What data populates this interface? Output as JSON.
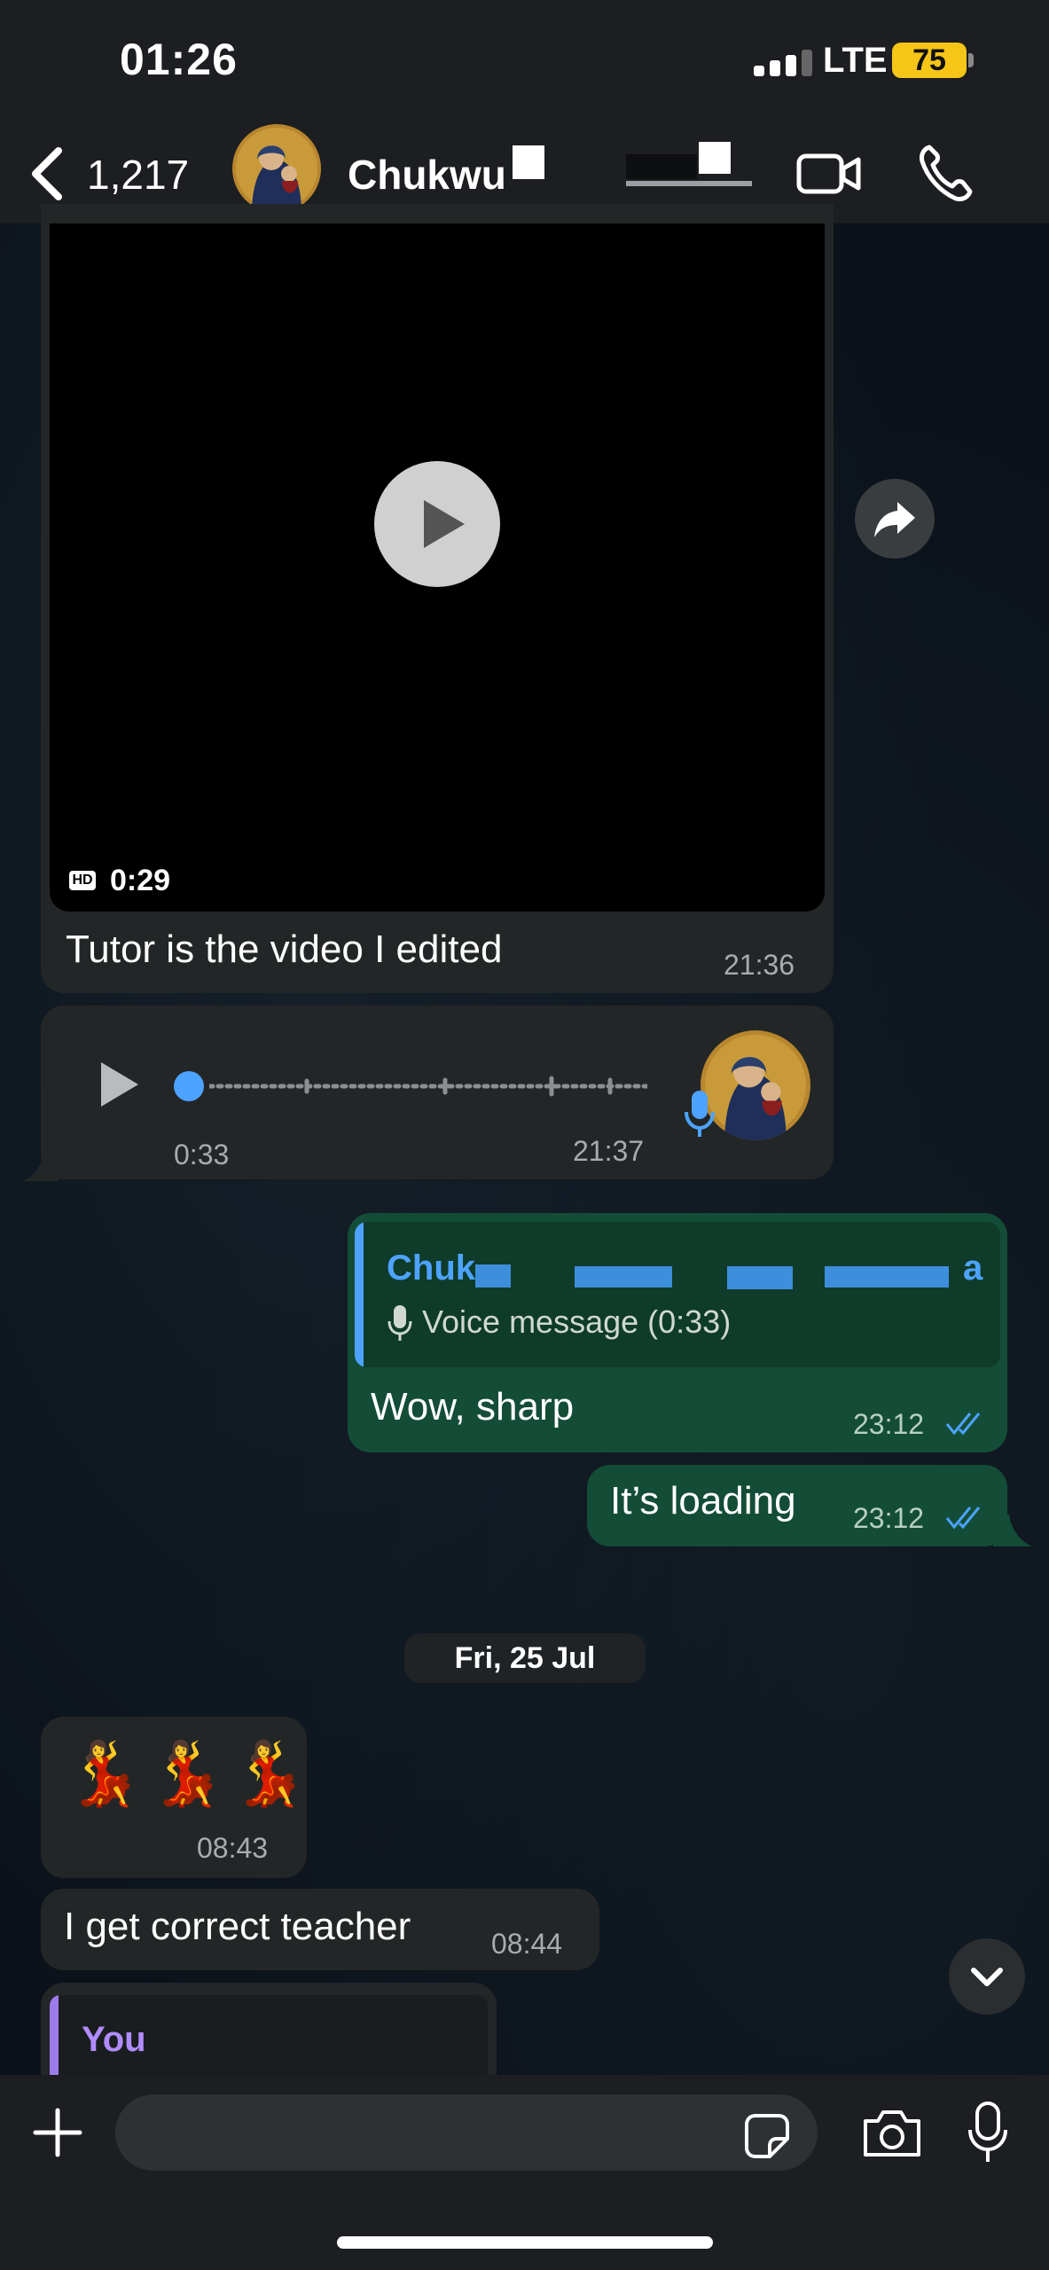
{
  "status_bar": {
    "time": "01:26",
    "network": "LTE",
    "battery": "75"
  },
  "header": {
    "back_count": "1,217",
    "contact_name": "Chukwu"
  },
  "messages": {
    "video": {
      "quality_badge": "HD",
      "duration": "0:29",
      "caption": "Tutor is the video I edited",
      "time": "21:36"
    },
    "voice": {
      "duration": "0:33",
      "time": "21:37"
    },
    "reply_sharp": {
      "quoted_name": "Chuk",
      "quoted_name_end": "a",
      "quoted_text": "Voice message (0:33)",
      "text": "Wow, sharp",
      "time": "23:12"
    },
    "loading": {
      "text": "It’s loading",
      "time": "23:12"
    },
    "date_separator": "Fri, 25 Jul",
    "emoji_msg": {
      "text": "💃💃💃",
      "time": "08:43"
    },
    "teacher": {
      "text": "I get correct teacher",
      "time": "08:44"
    },
    "you_reply": {
      "quoted_name": "You"
    }
  },
  "input": {
    "placeholder": ""
  },
  "colors": {
    "outgoing_bubble": "#144d37",
    "incoming_bubble": "#232627",
    "accent_blue": "#4da3ff",
    "you_purple": "#b18cff",
    "battery": "#f5c518"
  }
}
